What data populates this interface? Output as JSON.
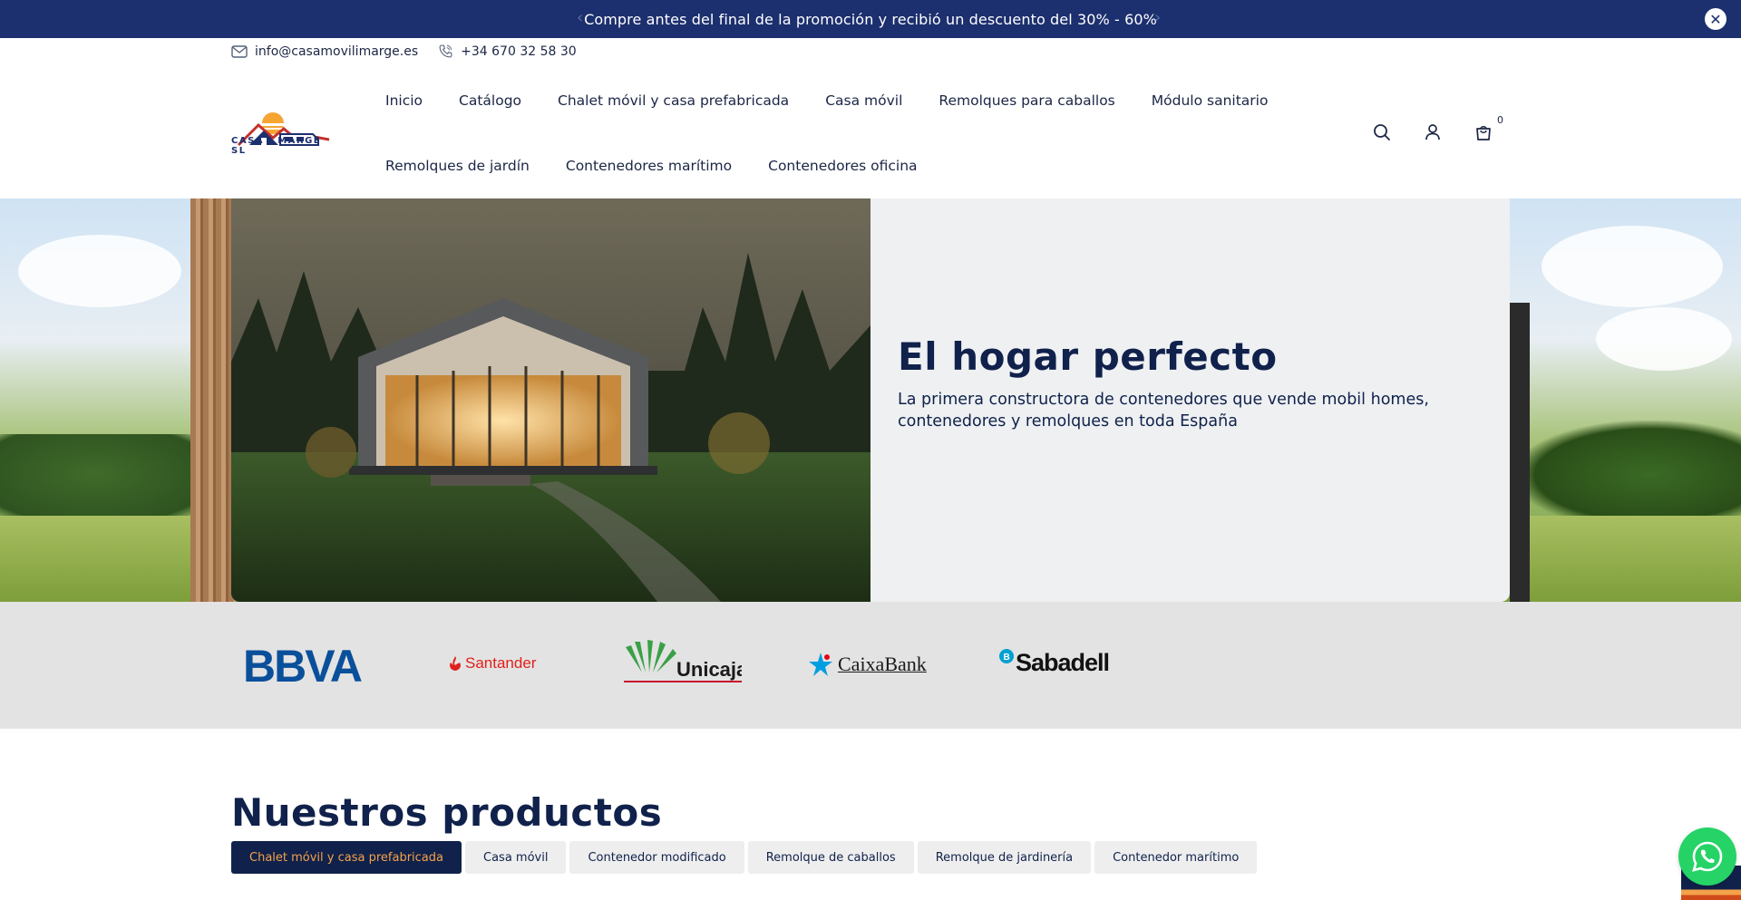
{
  "announcement": {
    "message": "Compre antes del final de la promoción y recibió un descuento del 30% - 60%",
    "prev_icon": "chevron-left-icon",
    "next_icon": "chevron-right-icon",
    "close_icon": "close-icon"
  },
  "contact": {
    "email": "info@casamovilimarge.es",
    "phone": "+34 670 32 58 30"
  },
  "logo": {
    "text": "CASA I MARGE SL"
  },
  "nav": {
    "row1": [
      "Inicio",
      "Catálogo",
      "Chalet móvil y casa prefabricada",
      "Casa móvil",
      "Remolques para caballos",
      "Módulo sanitario"
    ],
    "row2": [
      "Remolques de jardín",
      "Contenedores marítimo",
      "Contenedores oficina"
    ]
  },
  "header_icons": {
    "cart_count": "0"
  },
  "hero": {
    "title": "El hogar perfecto",
    "subtitle": "La primera constructora de contenedores que vende mobil homes, contenedores y remolques en toda España"
  },
  "banks": [
    "BBVA",
    "Santander",
    "Unicaja",
    "CaixaBank",
    "Sabadell"
  ],
  "products": {
    "title": "Nuestros productos",
    "tabs": [
      "Chalet móvil y casa prefabricada",
      "Casa móvil",
      "Contenedor modificado",
      "Remolque de caballos",
      "Remolque de jardinería",
      "Contenedor marítimo"
    ]
  },
  "colors": {
    "navy": "#10214b",
    "announcement_bg": "#1c2f6e",
    "accent_orange": "#f4a24a",
    "whatsapp": "#25d366"
  }
}
